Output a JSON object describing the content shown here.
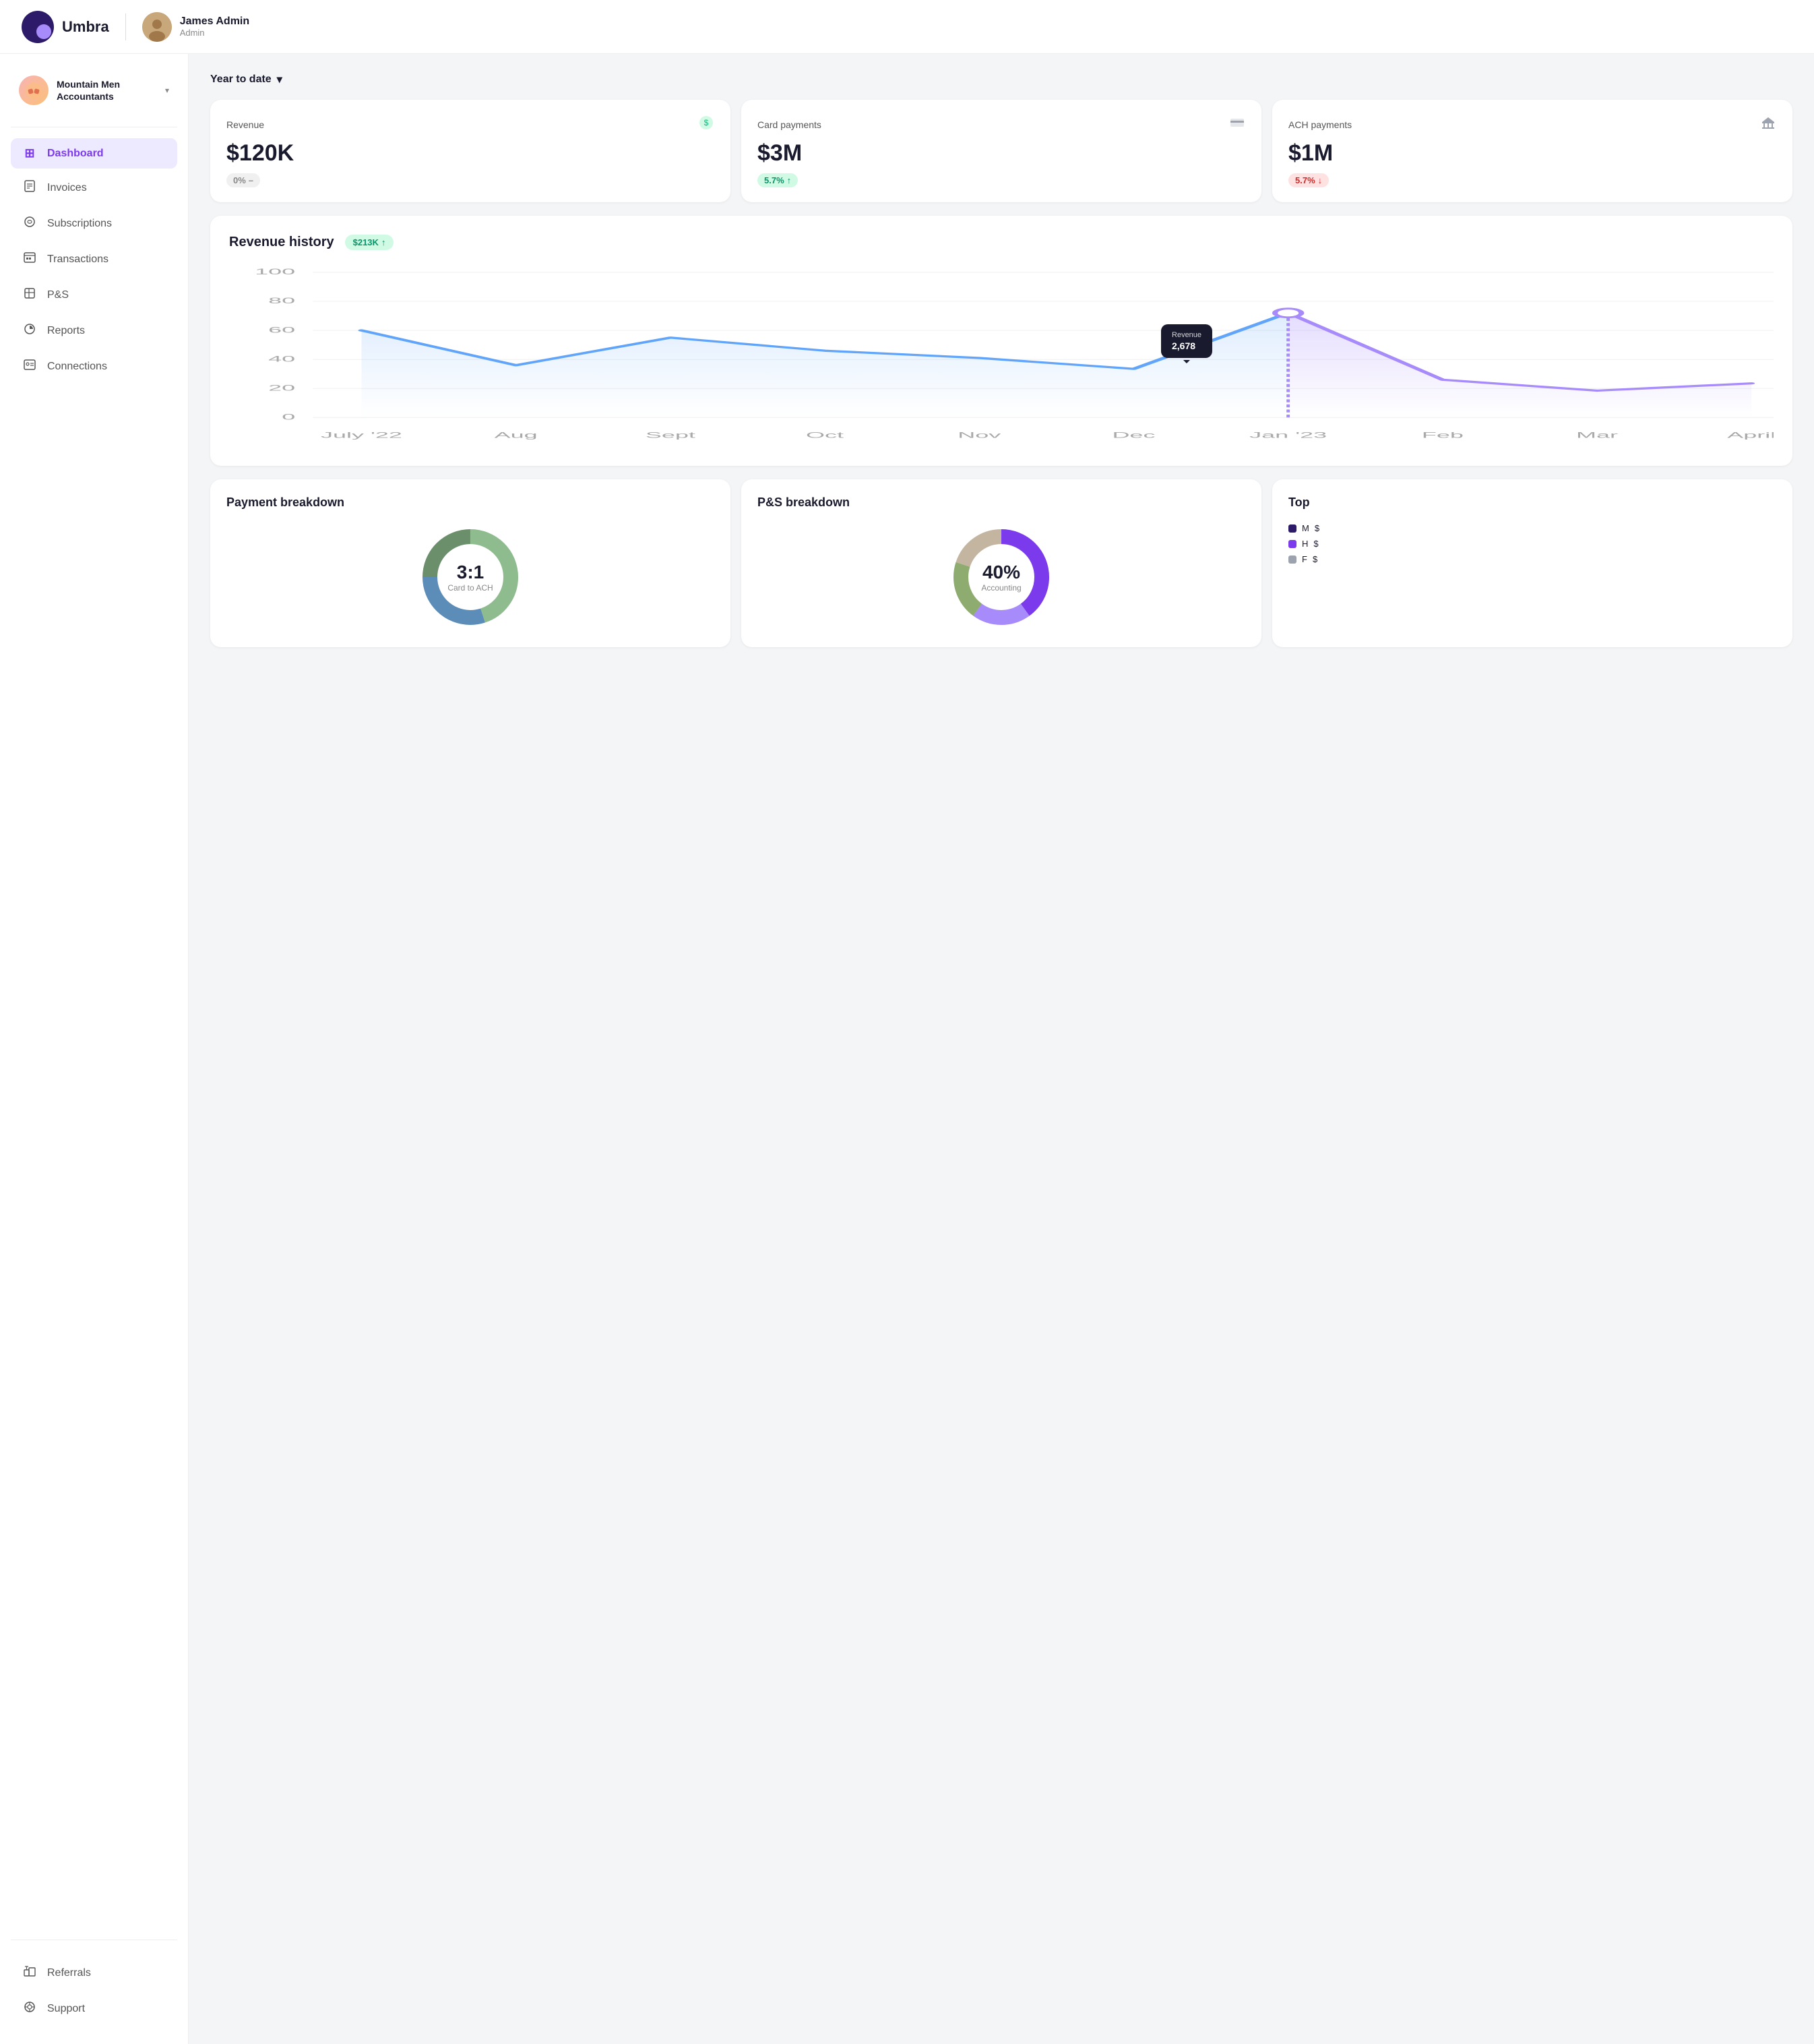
{
  "app": {
    "name": "Umbra",
    "logo_alt": "Umbra logo"
  },
  "user": {
    "name": "James Admin",
    "role": "Admin",
    "avatar_emoji": "👤"
  },
  "sidebar": {
    "org_name": "Mountain Men\nAccountants",
    "nav_items": [
      {
        "id": "dashboard",
        "label": "Dashboard",
        "icon": "⊞",
        "active": true
      },
      {
        "id": "invoices",
        "label": "Invoices",
        "icon": "🧾",
        "active": false
      },
      {
        "id": "subscriptions",
        "label": "Subscriptions",
        "icon": "🔄",
        "active": false
      },
      {
        "id": "transactions",
        "label": "Transactions",
        "icon": "📊",
        "active": false
      },
      {
        "id": "ps",
        "label": "P&S",
        "icon": "📋",
        "active": false
      },
      {
        "id": "reports",
        "label": "Reports",
        "icon": "📈",
        "active": false
      },
      {
        "id": "connections",
        "label": "Connections",
        "icon": "👥",
        "active": false
      }
    ],
    "bottom_items": [
      {
        "id": "referrals",
        "label": "Referrals",
        "icon": "🎁"
      },
      {
        "id": "support",
        "label": "Support",
        "icon": "💬"
      }
    ]
  },
  "period": {
    "label": "Year to date",
    "chevron": "▼"
  },
  "stats": [
    {
      "label": "Revenue",
      "value": "$120K",
      "icon": "💰",
      "icon_color": "#10b981",
      "badge_text": "0%",
      "badge_extra": "–",
      "badge_type": "neutral"
    },
    {
      "label": "Card payments",
      "value": "$3M",
      "icon": "💳",
      "icon_color": "#6b7280",
      "badge_text": "5.7%",
      "badge_extra": "↑",
      "badge_type": "up"
    },
    {
      "label": "ACH payments",
      "value": "$1M",
      "icon": "🏦",
      "icon_color": "#9ca3af",
      "badge_text": "5.7%",
      "badge_extra": "↓",
      "badge_type": "down"
    }
  ],
  "revenue_chart": {
    "title": "Revenue history",
    "badge_text": "$213K",
    "badge_arrow": "↑",
    "tooltip": {
      "label": "Revenue",
      "value": "2,678"
    },
    "y_labels": [
      "100",
      "80",
      "60",
      "40",
      "20",
      "0"
    ],
    "x_labels": [
      "July '22",
      "Aug",
      "Sept",
      "Oct",
      "Nov",
      "Dec",
      "Jan '23",
      "Feb",
      "Mar",
      "April"
    ]
  },
  "payment_breakdown": {
    "title": "Payment breakdown",
    "center_value": "3:1",
    "center_label": "Card to ACH",
    "segments": [
      {
        "color": "#5b8db8",
        "pct": 30
      },
      {
        "color": "#8fbc8f",
        "pct": 45
      },
      {
        "color": "#6b8f6b",
        "pct": 25
      }
    ]
  },
  "ps_breakdown": {
    "title": "P&S breakdown",
    "center_value": "40%",
    "center_label": "Accounting",
    "segments": [
      {
        "color": "#7c3aed",
        "pct": 40
      },
      {
        "color": "#a78bfa",
        "pct": 20
      },
      {
        "color": "#6b8f6b",
        "pct": 20
      },
      {
        "color": "#c4b5a0",
        "pct": 20
      }
    ]
  },
  "top_section": {
    "title": "Top",
    "items": [
      {
        "color": "#2d1b69",
        "name": "M",
        "value": "$"
      },
      {
        "color": "#7c3aed",
        "name": "H",
        "value": "$"
      },
      {
        "color": "#9ca3af",
        "name": "F",
        "value": "$"
      }
    ]
  }
}
